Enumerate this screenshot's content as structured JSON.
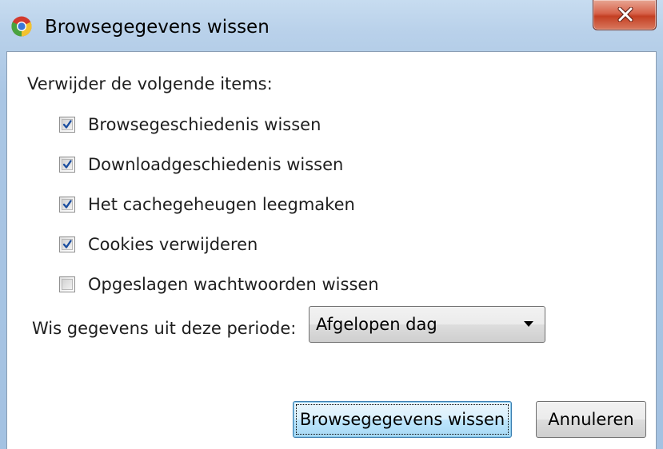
{
  "window": {
    "title": "Browsegegevens wissen",
    "app_icon": "chrome-icon",
    "close_icon": "close-icon"
  },
  "dialog": {
    "intro_label": "Verwijder de volgende items:",
    "options": [
      {
        "label": "Browsegeschiedenis wissen",
        "checked": true
      },
      {
        "label": "Downloadgeschiedenis wissen",
        "checked": true
      },
      {
        "label": "Het cachegeheugen leegmaken",
        "checked": true
      },
      {
        "label": "Cookies verwijderen",
        "checked": true
      },
      {
        "label": "Opgeslagen wachtwoorden wissen",
        "checked": false
      }
    ],
    "period_label": "Wis gegevens uit deze periode:",
    "period_value": "Afgelopen dag",
    "confirm_button": "Browsegegevens wissen",
    "cancel_button": "Annuleren"
  },
  "colors": {
    "frame": "#b9d1ea",
    "close_button": "#c43f22",
    "checkmark": "#1c4fa0",
    "primary_button": "#bee6fd"
  }
}
